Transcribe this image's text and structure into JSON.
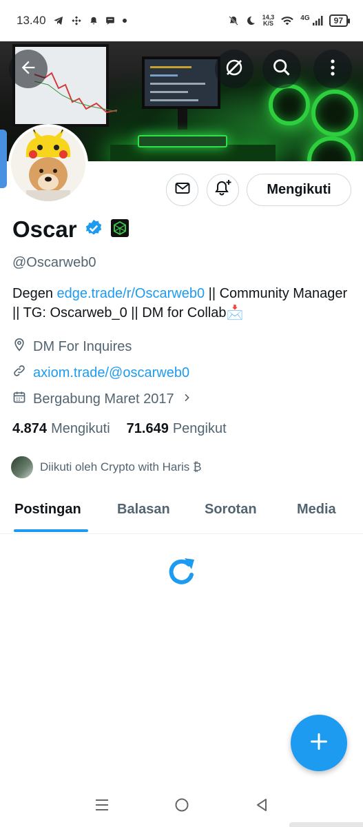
{
  "status_bar": {
    "time": "13.40",
    "net_speed_value": "14,3",
    "net_speed_unit": "K/S",
    "network": "4G",
    "battery": "97",
    "notification_icons": [
      "telegram-icon",
      "binance-icon",
      "bell-icon",
      "message-icon",
      "dot-icon"
    ],
    "system_icons": [
      "mute-bell-icon",
      "moon-icon",
      "wifi-icon",
      "signal-icon"
    ]
  },
  "header": {
    "back_icon": "back-arrow-icon",
    "grok_icon": "grok-icon",
    "search_icon": "search-icon",
    "more_icon": "more-vertical-icon"
  },
  "profile": {
    "name": "Oscar",
    "verified": true,
    "affiliate_badge": "cube-badge-icon",
    "handle": "@Oscarweb0",
    "bio_prefix": "Degen ",
    "bio_link": "edge.trade/r/Oscarweb0",
    "bio_suffix": " || Community Manager || TG: Oscarweb_0 || DM for Collab📩",
    "location": "DM For Inquires",
    "website": "axiom.trade/@oscarweb0",
    "joined": "Bergabung Maret 2017",
    "following_count": "4.874",
    "following_label": "Mengikuti",
    "followers_count": "71.649",
    "followers_label": "Pengikut",
    "followed_by": "Diikuti oleh Crypto with Haris ₿"
  },
  "actions": {
    "message_icon": "envelope-icon",
    "notify_icon": "bell-plus-icon",
    "follow_label": "Mengikuti"
  },
  "tabs": [
    {
      "label": "Postingan",
      "active": true
    },
    {
      "label": "Balasan",
      "active": false
    },
    {
      "label": "Sorotan",
      "active": false
    },
    {
      "label": "Media",
      "active": false
    }
  ],
  "content": {
    "loading_icon": "refresh-icon"
  },
  "fab": {
    "icon": "plus-icon"
  },
  "system_nav": {
    "recents_icon": "menu-lines-icon",
    "home_icon": "circle-home-icon",
    "back_icon": "triangle-back-icon"
  },
  "colors": {
    "accent": "#1d9bf0",
    "text_primary": "#0f1419",
    "text_secondary": "#536471",
    "badge_green": "#3ccf4e"
  }
}
